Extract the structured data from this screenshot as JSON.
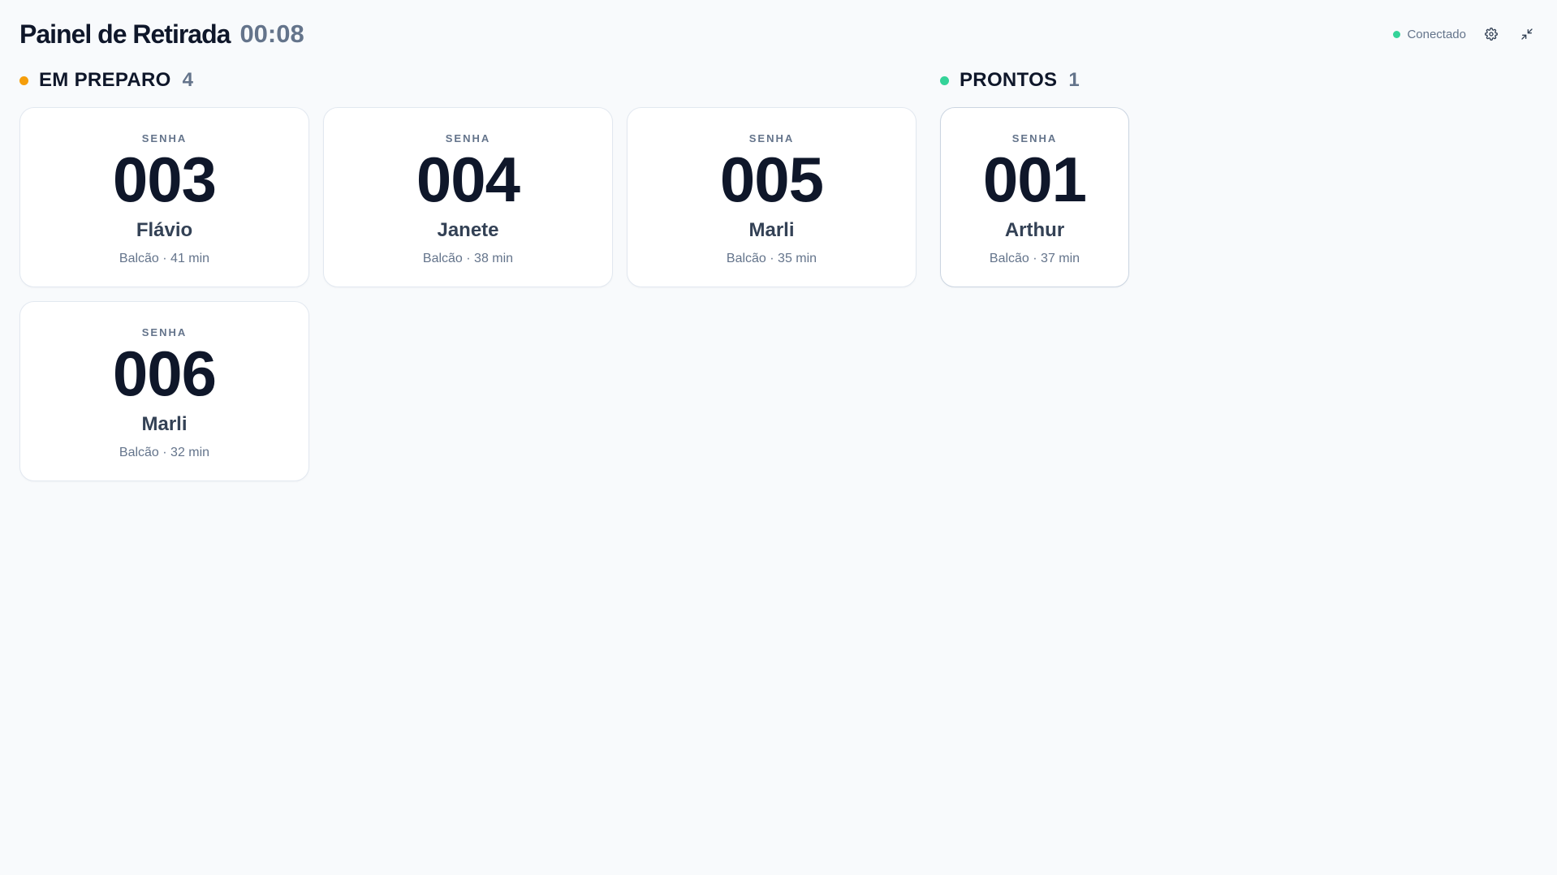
{
  "header": {
    "title": "Painel de Retirada",
    "clock": "00:08",
    "status_label": "Conectado",
    "status_color": "#34d399",
    "settings_icon": "gear-icon",
    "fullscreen_icon": "exit-fullscreen-icon"
  },
  "em_preparo": {
    "title": "EM PREPARO",
    "count": "4",
    "dot_color": "#f59e0b",
    "orders": [
      {
        "label": "SENHA",
        "number": "003",
        "name": "Flávio",
        "meta": "Balcão · 41 min"
      },
      {
        "label": "SENHA",
        "number": "004",
        "name": "Janete",
        "meta": "Balcão · 38 min"
      },
      {
        "label": "SENHA",
        "number": "005",
        "name": "Marli",
        "meta": "Balcão · 35 min"
      },
      {
        "label": "SENHA",
        "number": "006",
        "name": "Marli",
        "meta": "Balcão · 32 min"
      }
    ]
  },
  "prontos": {
    "title": "PRONTOS",
    "count": "1",
    "dot_color": "#34d399",
    "orders": [
      {
        "label": "SENHA",
        "number": "001",
        "name": "Arthur",
        "meta": "Balcão · 37 min"
      }
    ]
  }
}
